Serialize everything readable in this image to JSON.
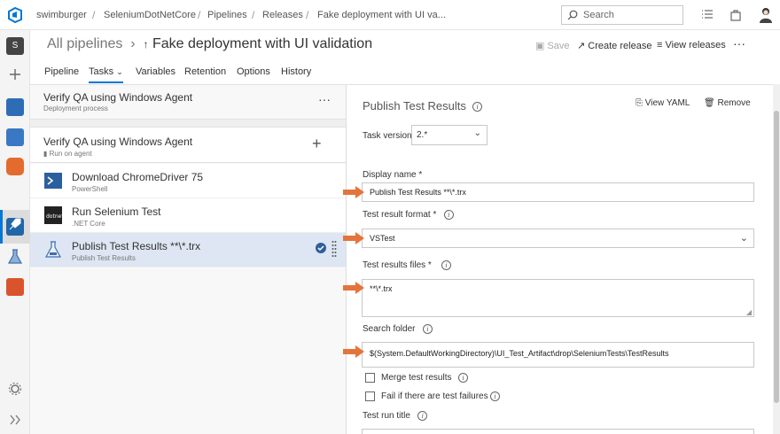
{
  "breadcrumb": [
    "swimburger",
    "SeleniumDotNetCore",
    "Pipelines",
    "Releases",
    "Fake deployment with UI va..."
  ],
  "search": {
    "placeholder": "Search"
  },
  "header": {
    "all_pipelines": "All pipelines",
    "title": "Fake deployment with UI validation",
    "save": "Save",
    "create_release": "Create release",
    "view_releases": "View releases",
    "more": "···"
  },
  "tabs": [
    "Pipeline",
    "Tasks",
    "Variables",
    "Retention",
    "Options",
    "History"
  ],
  "stage": {
    "title": "Verify QA using Windows Agent",
    "subtitle": "Deployment process",
    "more": "···"
  },
  "agent_job": {
    "title": "Verify QA using Windows Agent",
    "subtitle": "Run on agent",
    "add": "+"
  },
  "tasks": [
    {
      "title": "Download ChromeDriver 75",
      "subtitle": "PowerShell"
    },
    {
      "title": "Run Selenium Test",
      "subtitle": ".NET Core"
    },
    {
      "title": "Publish Test Results **\\*.trx",
      "subtitle": "Publish Test Results"
    }
  ],
  "panel": {
    "title": "Publish Test Results",
    "view_yaml": "View YAML",
    "remove": "Remove",
    "task_version_label": "Task version",
    "task_version": "2.*",
    "display_name_label": "Display name *",
    "display_name": "Publish Test Results **\\*.trx",
    "format_label": "Test result format *",
    "format": "VSTest",
    "files_label": "Test results files *",
    "files": "**\\*.trx",
    "search_folder_label": "Search folder",
    "search_folder": "$(System.DefaultWorkingDirectory)\\UI_Test_Artifact\\drop\\SeleniumTests\\TestResults",
    "merge_label": "Merge test results",
    "fail_label": "Fail if there are test failures",
    "run_title_label": "Test run title"
  },
  "colors": {
    "accent": "#0078d4",
    "arrow": "#e3753c",
    "rail": "#f4f4f4"
  }
}
